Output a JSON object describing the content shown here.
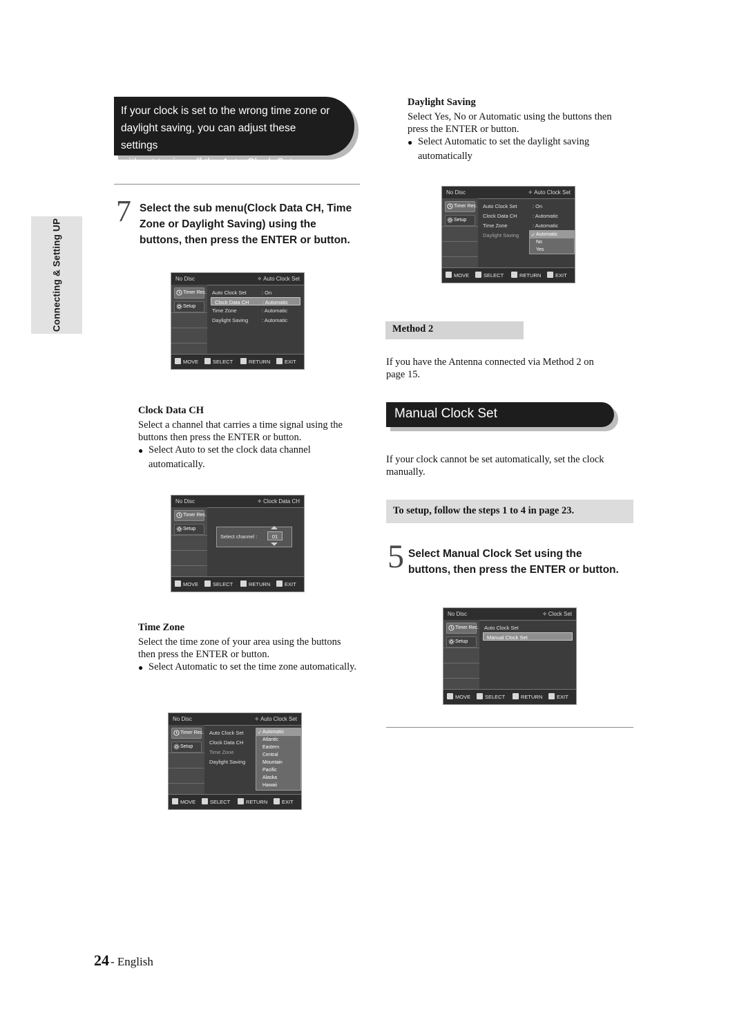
{
  "sidebar": {
    "tab_label": "Connecting & Setting UP"
  },
  "note_banner": {
    "line1": "If your clock is set to the wrong time zone or",
    "line2": "daylight saving, you can adjust these settings",
    "line3": "without tuning off the Auto Clock Set function."
  },
  "step7": {
    "number": "7",
    "line1": "Select the sub menu(Clock Data CH, Time",
    "line2": "Zone or Daylight Saving) using the",
    "line3": "buttons, then press the ENTER or      button."
  },
  "clock_data_ch": {
    "heading": "Clock Data CH",
    "p1": "Select a channel that carries a time signal using the",
    "p2": "buttons then press the ENTER or      button.",
    "bullet": "Select Auto to set the clock data channel automatically."
  },
  "time_zone": {
    "heading": "Time Zone",
    "p1": "Select the time zone of your area using the          buttons",
    "p2": "then press the ENTER or      button.",
    "bullet": "Select Automatic to set the time zone automatically."
  },
  "daylight_saving": {
    "heading": "Daylight Saving",
    "p1": "Select Yes, No or Automatic using the        buttons then",
    "p2": "press the ENTER or      button.",
    "bullet1": "Select Automatic to set the daylight saving",
    "bullet2": "automatically"
  },
  "method2": {
    "bar_label": "Method  2",
    "p1": "If you have the Antenna connected via Method 2 on",
    "p2": "page  15."
  },
  "manual_clock_set": {
    "title": "Manual Clock Set",
    "p1": "If your clock cannot be set automatically, set the clock",
    "p2": "manually.",
    "info_strip": "To setup, follow the steps 1 to 4 in page  23.",
    "step_number": "5",
    "step_line1": "Select Manual Clock Set using the",
    "step_line2": "buttons, then press the ENTER or      button."
  },
  "osd_common": {
    "no_disc": "No Disc",
    "timer_rec": "Timer Rec.",
    "setup": "Setup",
    "bottom": [
      {
        "label": "MOVE"
      },
      {
        "label": "SELECT"
      },
      {
        "label": "RETURN"
      },
      {
        "label": "EXIT"
      }
    ]
  },
  "osd1": {
    "title": "Auto Clock Set",
    "rows": [
      {
        "label": "Auto Clock Set",
        "value": ": On"
      },
      {
        "label": "Clock Data CH",
        "value": ": Automatic"
      },
      {
        "label": "Time Zone",
        "value": ": Automatic"
      },
      {
        "label": "Daylight Saving",
        "value": ": Automatic"
      }
    ],
    "highlight_index": 1
  },
  "osd2": {
    "title": "Clock Data CH",
    "select_channel_label": "Select channel :",
    "channel_value": "01"
  },
  "osd3": {
    "title": "Auto Clock Set",
    "rows": [
      {
        "label": "Auto Clock Set",
        "value": ""
      },
      {
        "label": "Clock Data CH",
        "value": ""
      },
      {
        "label": "Time Zone",
        "value": ""
      },
      {
        "label": "Daylight Saving",
        "value": ""
      }
    ],
    "highlight_index": 2,
    "options": [
      "Automatic",
      "Atlantic",
      "Eastern",
      "Central",
      "Mountain",
      "Pacific",
      "Alaska",
      "Hawaii"
    ],
    "selected_option": "Automatic"
  },
  "osd4": {
    "title": "Auto Clock Set",
    "rows": [
      {
        "label": "Auto Clock Set",
        "value": ": On"
      },
      {
        "label": "Clock Data CH",
        "value": ": Automatic"
      },
      {
        "label": "Time Zone",
        "value": ": Automatic"
      },
      {
        "label": "Daylight Saving",
        "value": ""
      }
    ],
    "highlight_index": 3,
    "options": [
      "Automatic",
      "No",
      "Yes"
    ],
    "selected_option": "Automatic"
  },
  "osd5": {
    "title": "Clock Set",
    "rows": [
      {
        "label": "Auto Clock Set",
        "value": ""
      },
      {
        "label": "Manual Clock Set",
        "value": ""
      }
    ],
    "highlight_index": 1
  },
  "footer": {
    "page": "24",
    "language": "- English"
  }
}
